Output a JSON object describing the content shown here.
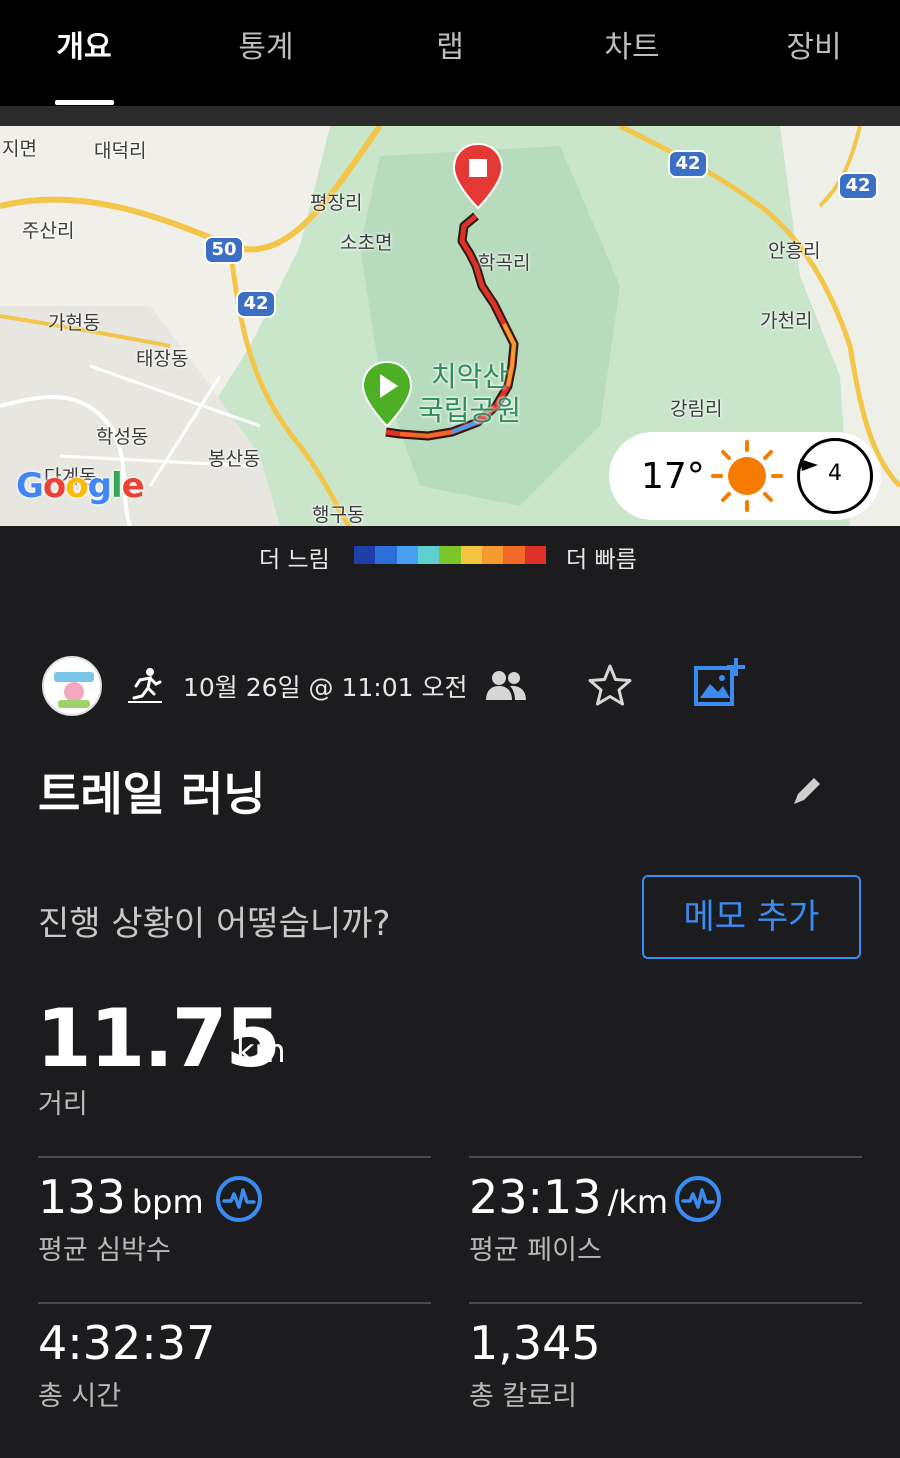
{
  "tabs": [
    {
      "label": "개요",
      "active": true
    },
    {
      "label": "통계",
      "active": false
    },
    {
      "label": "랩",
      "active": false
    },
    {
      "label": "차트",
      "active": false
    },
    {
      "label": "장비",
      "active": false
    }
  ],
  "map": {
    "labels": {
      "l1": "지면",
      "l2": "대덕리",
      "l3": "주산리",
      "l4": "가현동",
      "l5": "태장동",
      "l6": "학성동",
      "l7": "봉산동",
      "l8": "행구동",
      "l9": "평장리",
      "l10": "소초면",
      "l11": "학곡리",
      "l12": "안흥리",
      "l13": "가천리",
      "l14": "강림리",
      "l15": "다계동"
    },
    "park": "치악산\n국립공원",
    "routes": {
      "r50": "50",
      "r42a": "42",
      "r42b": "42",
      "r42c": "42"
    },
    "google": "Google",
    "weather": {
      "temp": "17°",
      "wind": "4"
    }
  },
  "legend": {
    "slower": "더 느림",
    "faster": "더 빠름",
    "colors": [
      "#1e3fa8",
      "#2d6fd8",
      "#4aa0f0",
      "#5fd0d0",
      "#7cc62c",
      "#f5c542",
      "#f59b2f",
      "#f06a28",
      "#e0302a"
    ]
  },
  "activity": {
    "date": "10월 26일 @ 11:01 오전",
    "title": "트레일 러닝",
    "question": "진행 상황이 어떻습니까?",
    "memo_button": "메모 추가"
  },
  "stats": {
    "distance": {
      "value": "11.75",
      "unit": "km",
      "label": "거리"
    },
    "heart_rate": {
      "value": "133",
      "unit": "bpm",
      "label": "평균 심박수"
    },
    "pace": {
      "value": "23:13",
      "unit": "/km",
      "label": "평균 페이스"
    },
    "time": {
      "value": "4:32:37",
      "label": "총 시간"
    },
    "calories": {
      "value": "1,345",
      "label": "총 칼로리"
    }
  },
  "colors": {
    "accent": "#3b8cf2",
    "start_pin": "#4caf24",
    "end_pin": "#e53935"
  }
}
